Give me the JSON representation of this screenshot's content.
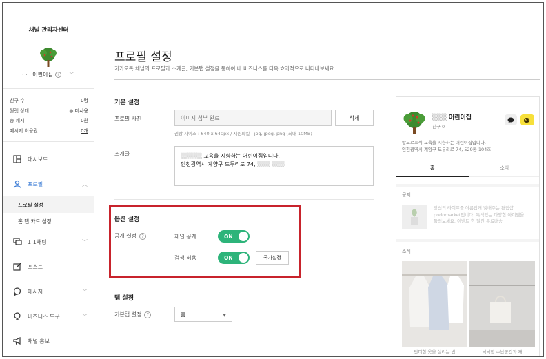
{
  "sidebar": {
    "title": "채널 관리자센터",
    "channel_name": "· · ·  어린이집",
    "stats": [
      {
        "label": "친구 수",
        "value": "0명"
      },
      {
        "label": "월렛 상태",
        "value": "미사용"
      },
      {
        "label": "총 캐시",
        "value": "0원"
      },
      {
        "label": "메시지 이용권",
        "value": "0개"
      }
    ],
    "menu": {
      "dashboard": "대시보드",
      "profile": "프로필",
      "profile_settings": "프로필 설정",
      "home_tab_card": "홈 탭 카드 설정",
      "chat": "1:1채팅",
      "post": "포스트",
      "message": "메시지",
      "business_tools": "비즈니스 도구",
      "promotion": "채널 홍보"
    }
  },
  "main": {
    "title": "프로필 설정",
    "subtitle": "카카오톡 채널의 프로필과 소개글, 기본탭 설정을 통하여 내 비즈니스를 더욱 효과적으로 나타내보세요.",
    "basic": {
      "title": "기본 설정",
      "photo_label": "프로필 사진",
      "photo_value": "이미지 첨부 완료",
      "delete_button": "삭제",
      "photo_hint": "권장 사이즈 : 640 x 640px / 지원파일 : jpg, jpeg, png (최대 10MB)",
      "intro_label": "소개글",
      "intro_line1": "교육을 지향하는 어린이집입니다.",
      "intro_line2": "인천광역시 계양구 도두리로 74,"
    },
    "options": {
      "title": "옵션 설정",
      "visibility_label": "공개 설정",
      "channel_public_label": "채널 공개",
      "channel_public_state": "ON",
      "search_allow_label": "검색 허용",
      "search_allow_state": "ON",
      "country_button": "국가설정"
    },
    "tab": {
      "title": "탭 설정",
      "default_tab_label": "기본탭 설정",
      "default_tab_value": "홈"
    }
  },
  "preview": {
    "name": "어린이집",
    "friends": "친구 0",
    "desc_line1": "발도르프식 교육을 지향하는 어린이집입니다.",
    "desc_line2": "인천광역시 계양구 도두리로 74, 529동 104호",
    "tab_home": "홈",
    "tab_news": "소식",
    "notice_title": "공지",
    "notice_text1": "당신의 라이프를 아름답게 빛내주는 편집샵",
    "notice_text2": "podomarket입니다. 특색있는 다양한 아이템을",
    "notice_text3": "둘러보세요. 이벤트 한 달간 무료배송",
    "news_title": "소식",
    "card1_caption": "단디한 옷을 살리는 법",
    "card2_caption": "넉넉한 수납공간과 재",
    "chat_button": "💬",
    "add_button": "친+"
  },
  "colors": {
    "accent_blue": "#3a7bd5",
    "toggle_green": "#2db47a",
    "highlight_red": "#c8232c",
    "kakao_yellow": "#f7e03a"
  }
}
